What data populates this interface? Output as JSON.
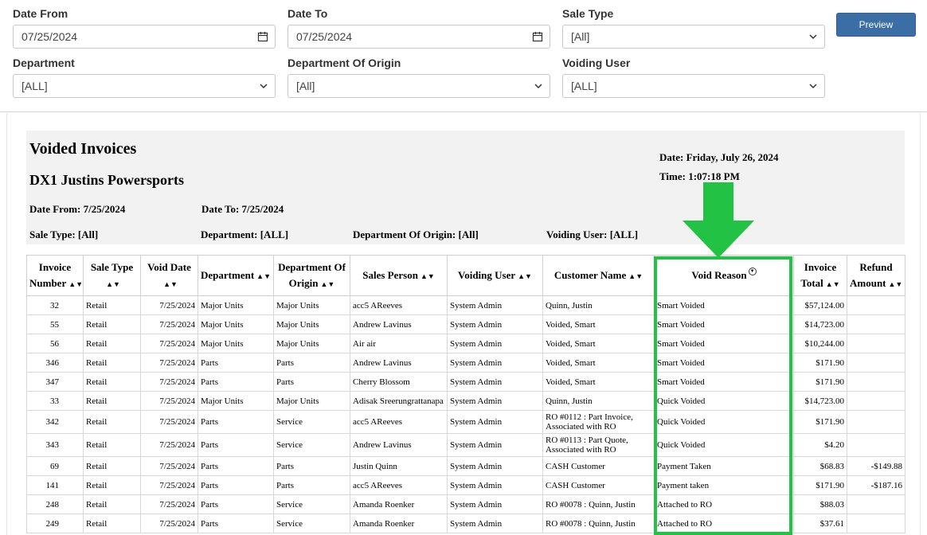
{
  "filters": {
    "date_from": {
      "label": "Date From",
      "value": "07/25/2024",
      "icon": "calendar-icon"
    },
    "date_to": {
      "label": "Date To",
      "value": "07/25/2024",
      "icon": "calendar-icon"
    },
    "sale_type": {
      "label": "Sale Type",
      "value": "[All]",
      "icon": "chevron-down-icon"
    },
    "department": {
      "label": "Department",
      "value": "[ALL]",
      "icon": "chevron-down-icon"
    },
    "department_origin": {
      "label": "Department Of Origin",
      "value": "[All]",
      "icon": "chevron-down-icon"
    },
    "voiding_user": {
      "label": "Voiding User",
      "value": "[ALL]",
      "icon": "chevron-down-icon"
    },
    "preview_label": "Preview"
  },
  "report": {
    "title": "Voided Invoices",
    "company": "DX1 Justins Powersports",
    "date": "Date: Friday, July 26, 2024",
    "time": "Time: 1:07:18 PM",
    "date_from": "Date From: 7/25/2024",
    "date_to": "Date To: 7/25/2024",
    "sale_type": "Sale Type: [All]",
    "department": "Department: [ALL]",
    "department_origin": "Department Of Origin: [All]",
    "voiding_user": "Voiding User: [ALL]"
  },
  "columns": [
    {
      "line1": "Invoice",
      "line2": "Number"
    },
    {
      "line1": "Sale Type",
      "line2": ""
    },
    {
      "line1": "Void Date",
      "line2": ""
    },
    {
      "line1": "Department",
      "line2": ""
    },
    {
      "line1": "Department Of",
      "line2": "Origin"
    },
    {
      "line1": "Sales Person",
      "line2": ""
    },
    {
      "line1": "Voiding User",
      "line2": ""
    },
    {
      "line1": "Customer Name",
      "line2": ""
    },
    {
      "line1": "Void Reason",
      "line2": ""
    },
    {
      "line1": "Invoice",
      "line2": "Total"
    },
    {
      "line1": "Refund",
      "line2": "Amount"
    }
  ],
  "rows": [
    [
      "32",
      "Retail",
      "7/25/2024",
      "Major Units",
      "Major Units",
      "acc5 AReeves",
      "System Admin",
      "Quinn, Justin",
      "Smart Voided",
      "$57,124.00",
      ""
    ],
    [
      "55",
      "Retail",
      "7/25/2024",
      "Major Units",
      "Major Units",
      "Andrew Lavinus",
      "System Admin",
      "Voided, Smart",
      "Smart Voided",
      "$14,723.00",
      ""
    ],
    [
      "56",
      "Retail",
      "7/25/2024",
      "Major Units",
      "Major Units",
      "Air air",
      "System Admin",
      "Voided, Smart",
      "Smart Voided",
      "$10,244.00",
      ""
    ],
    [
      "346",
      "Retail",
      "7/25/2024",
      "Parts",
      "Parts",
      "Andrew Lavinus",
      "System Admin",
      "Voided, Smart",
      "Smart Voided",
      "$171.90",
      ""
    ],
    [
      "347",
      "Retail",
      "7/25/2024",
      "Parts",
      "Parts",
      "Cherry Blossom",
      "System Admin",
      "Voided, Smart",
      "Smart Voided",
      "$171.90",
      ""
    ],
    [
      "33",
      "Retail",
      "7/25/2024",
      "Major Units",
      "Major Units",
      "Adisak Sreerungrattanapa",
      "System Admin",
      "Quinn, Justin",
      "Quick Voided",
      "$14,723.00",
      ""
    ],
    [
      "342",
      "Retail",
      "7/25/2024",
      "Parts",
      "Service",
      "acc5 AReeves",
      "System Admin",
      "RO #0112 : Part Invoice, Associated with RO",
      "Quick Voided",
      "$171.90",
      ""
    ],
    [
      "343",
      "Retail",
      "7/25/2024",
      "Parts",
      "Service",
      "Andrew Lavinus",
      "System Admin",
      "RO #0113 : Part Quote, Associated with RO",
      "Quick Voided",
      "$4.20",
      ""
    ],
    [
      "69",
      "Retail",
      "7/25/2024",
      "Parts",
      "Parts",
      "Justin Quinn",
      "System Admin",
      "CASH Customer",
      "Payment Taken",
      "$68.83",
      "-$149.88"
    ],
    [
      "141",
      "Retail",
      "7/25/2024",
      "Parts",
      "Parts",
      "acc5 AReeves",
      "System Admin",
      "CASH Customer",
      "Payment taken",
      "$171.90",
      "-$187.16"
    ],
    [
      "248",
      "Retail",
      "7/25/2024",
      "Parts",
      "Service",
      "Amanda Roenker",
      "System Admin",
      "RO #0078 : Quinn, Justin",
      "Attached to RO",
      "$88.03",
      ""
    ],
    [
      "249",
      "Retail",
      "7/25/2024",
      "Parts",
      "Service",
      "Amanda Roenker",
      "System Admin",
      "RO #0078 : Quinn, Justin",
      "Attached to RO",
      "$37.61",
      ""
    ]
  ],
  "colors": {
    "highlight": "#22c244",
    "preview": "#3a6ea5"
  }
}
